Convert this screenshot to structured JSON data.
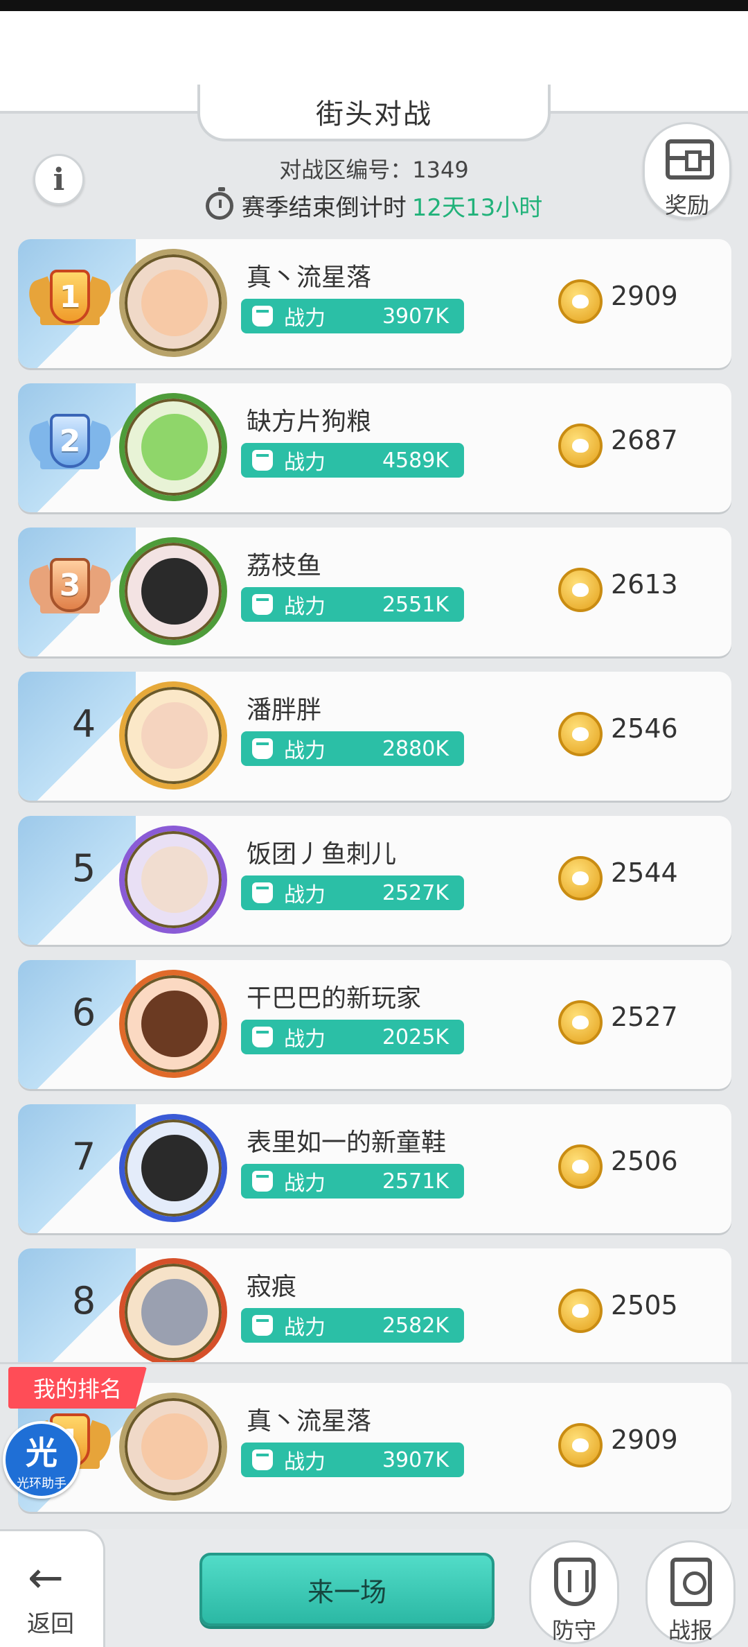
{
  "header": {
    "title": "街头对战",
    "zone_label": "对战区编号：",
    "zone_number": "1349",
    "countdown_label": "赛季结束倒计时",
    "countdown_value": "12天13小时",
    "reward_label": "奖励",
    "info_icon": "info-icon"
  },
  "ranking": [
    {
      "rank": "1",
      "name": "真丶流星落",
      "power_label": "战力",
      "power": "3907K",
      "score": "2909",
      "medal": "gold"
    },
    {
      "rank": "2",
      "name": "缺方片狗粮",
      "power_label": "战力",
      "power": "4589K",
      "score": "2687",
      "medal": "silver"
    },
    {
      "rank": "3",
      "name": "荔枝鱼",
      "power_label": "战力",
      "power": "2551K",
      "score": "2613",
      "medal": "bronze"
    },
    {
      "rank": "4",
      "name": "潘胖胖",
      "power_label": "战力",
      "power": "2880K",
      "score": "2546"
    },
    {
      "rank": "5",
      "name": "饭团丿鱼刺儿",
      "power_label": "战力",
      "power": "2527K",
      "score": "2544"
    },
    {
      "rank": "6",
      "name": "干巴巴的新玩家",
      "power_label": "战力",
      "power": "2025K",
      "score": "2527"
    },
    {
      "rank": "7",
      "name": "表里如一的新童鞋",
      "power_label": "战力",
      "power": "2571K",
      "score": "2506"
    },
    {
      "rank": "8",
      "name": "寂痕",
      "power_label": "战力",
      "power": "2582K",
      "score": "2505"
    }
  ],
  "my_rank": {
    "tag": "我的排名",
    "name": "真丶流星落",
    "power_label": "战力",
    "power": "3907K",
    "score": "2909"
  },
  "helper": {
    "big": "光",
    "small": "光环助手"
  },
  "bottom": {
    "back_label": "返回",
    "fight_label": "来一场",
    "defend_label": "防守",
    "report_label": "战报"
  },
  "colors": {
    "accent": "#2bbfa6",
    "countdown": "#21b27a",
    "my_rank_tag": "#ff4d57",
    "rank_strip": "#9dc9ea"
  }
}
